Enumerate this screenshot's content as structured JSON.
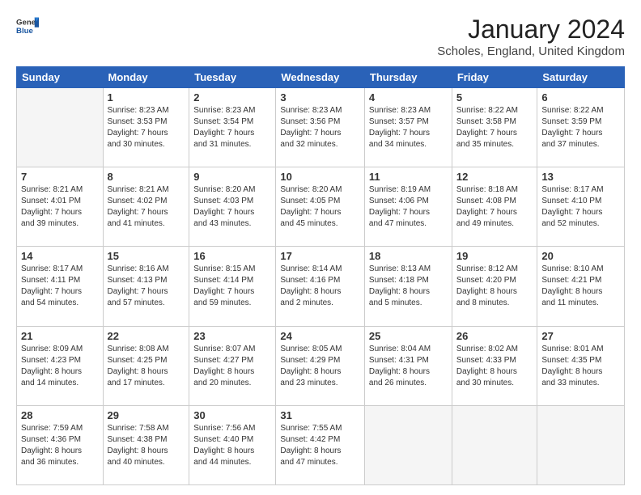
{
  "logo": {
    "general": "General",
    "blue": "Blue"
  },
  "title": "January 2024",
  "location": "Scholes, England, United Kingdom",
  "days_header": [
    "Sunday",
    "Monday",
    "Tuesday",
    "Wednesday",
    "Thursday",
    "Friday",
    "Saturday"
  ],
  "weeks": [
    [
      {
        "day": "",
        "lines": []
      },
      {
        "day": "1",
        "lines": [
          "Sunrise: 8:23 AM",
          "Sunset: 3:53 PM",
          "Daylight: 7 hours",
          "and 30 minutes."
        ]
      },
      {
        "day": "2",
        "lines": [
          "Sunrise: 8:23 AM",
          "Sunset: 3:54 PM",
          "Daylight: 7 hours",
          "and 31 minutes."
        ]
      },
      {
        "day": "3",
        "lines": [
          "Sunrise: 8:23 AM",
          "Sunset: 3:56 PM",
          "Daylight: 7 hours",
          "and 32 minutes."
        ]
      },
      {
        "day": "4",
        "lines": [
          "Sunrise: 8:23 AM",
          "Sunset: 3:57 PM",
          "Daylight: 7 hours",
          "and 34 minutes."
        ]
      },
      {
        "day": "5",
        "lines": [
          "Sunrise: 8:22 AM",
          "Sunset: 3:58 PM",
          "Daylight: 7 hours",
          "and 35 minutes."
        ]
      },
      {
        "day": "6",
        "lines": [
          "Sunrise: 8:22 AM",
          "Sunset: 3:59 PM",
          "Daylight: 7 hours",
          "and 37 minutes."
        ]
      }
    ],
    [
      {
        "day": "7",
        "lines": [
          "Sunrise: 8:21 AM",
          "Sunset: 4:01 PM",
          "Daylight: 7 hours",
          "and 39 minutes."
        ]
      },
      {
        "day": "8",
        "lines": [
          "Sunrise: 8:21 AM",
          "Sunset: 4:02 PM",
          "Daylight: 7 hours",
          "and 41 minutes."
        ]
      },
      {
        "day": "9",
        "lines": [
          "Sunrise: 8:20 AM",
          "Sunset: 4:03 PM",
          "Daylight: 7 hours",
          "and 43 minutes."
        ]
      },
      {
        "day": "10",
        "lines": [
          "Sunrise: 8:20 AM",
          "Sunset: 4:05 PM",
          "Daylight: 7 hours",
          "and 45 minutes."
        ]
      },
      {
        "day": "11",
        "lines": [
          "Sunrise: 8:19 AM",
          "Sunset: 4:06 PM",
          "Daylight: 7 hours",
          "and 47 minutes."
        ]
      },
      {
        "day": "12",
        "lines": [
          "Sunrise: 8:18 AM",
          "Sunset: 4:08 PM",
          "Daylight: 7 hours",
          "and 49 minutes."
        ]
      },
      {
        "day": "13",
        "lines": [
          "Sunrise: 8:17 AM",
          "Sunset: 4:10 PM",
          "Daylight: 7 hours",
          "and 52 minutes."
        ]
      }
    ],
    [
      {
        "day": "14",
        "lines": [
          "Sunrise: 8:17 AM",
          "Sunset: 4:11 PM",
          "Daylight: 7 hours",
          "and 54 minutes."
        ]
      },
      {
        "day": "15",
        "lines": [
          "Sunrise: 8:16 AM",
          "Sunset: 4:13 PM",
          "Daylight: 7 hours",
          "and 57 minutes."
        ]
      },
      {
        "day": "16",
        "lines": [
          "Sunrise: 8:15 AM",
          "Sunset: 4:14 PM",
          "Daylight: 7 hours",
          "and 59 minutes."
        ]
      },
      {
        "day": "17",
        "lines": [
          "Sunrise: 8:14 AM",
          "Sunset: 4:16 PM",
          "Daylight: 8 hours",
          "and 2 minutes."
        ]
      },
      {
        "day": "18",
        "lines": [
          "Sunrise: 8:13 AM",
          "Sunset: 4:18 PM",
          "Daylight: 8 hours",
          "and 5 minutes."
        ]
      },
      {
        "day": "19",
        "lines": [
          "Sunrise: 8:12 AM",
          "Sunset: 4:20 PM",
          "Daylight: 8 hours",
          "and 8 minutes."
        ]
      },
      {
        "day": "20",
        "lines": [
          "Sunrise: 8:10 AM",
          "Sunset: 4:21 PM",
          "Daylight: 8 hours",
          "and 11 minutes."
        ]
      }
    ],
    [
      {
        "day": "21",
        "lines": [
          "Sunrise: 8:09 AM",
          "Sunset: 4:23 PM",
          "Daylight: 8 hours",
          "and 14 minutes."
        ]
      },
      {
        "day": "22",
        "lines": [
          "Sunrise: 8:08 AM",
          "Sunset: 4:25 PM",
          "Daylight: 8 hours",
          "and 17 minutes."
        ]
      },
      {
        "day": "23",
        "lines": [
          "Sunrise: 8:07 AM",
          "Sunset: 4:27 PM",
          "Daylight: 8 hours",
          "and 20 minutes."
        ]
      },
      {
        "day": "24",
        "lines": [
          "Sunrise: 8:05 AM",
          "Sunset: 4:29 PM",
          "Daylight: 8 hours",
          "and 23 minutes."
        ]
      },
      {
        "day": "25",
        "lines": [
          "Sunrise: 8:04 AM",
          "Sunset: 4:31 PM",
          "Daylight: 8 hours",
          "and 26 minutes."
        ]
      },
      {
        "day": "26",
        "lines": [
          "Sunrise: 8:02 AM",
          "Sunset: 4:33 PM",
          "Daylight: 8 hours",
          "and 30 minutes."
        ]
      },
      {
        "day": "27",
        "lines": [
          "Sunrise: 8:01 AM",
          "Sunset: 4:35 PM",
          "Daylight: 8 hours",
          "and 33 minutes."
        ]
      }
    ],
    [
      {
        "day": "28",
        "lines": [
          "Sunrise: 7:59 AM",
          "Sunset: 4:36 PM",
          "Daylight: 8 hours",
          "and 36 minutes."
        ]
      },
      {
        "day": "29",
        "lines": [
          "Sunrise: 7:58 AM",
          "Sunset: 4:38 PM",
          "Daylight: 8 hours",
          "and 40 minutes."
        ]
      },
      {
        "day": "30",
        "lines": [
          "Sunrise: 7:56 AM",
          "Sunset: 4:40 PM",
          "Daylight: 8 hours",
          "and 44 minutes."
        ]
      },
      {
        "day": "31",
        "lines": [
          "Sunrise: 7:55 AM",
          "Sunset: 4:42 PM",
          "Daylight: 8 hours",
          "and 47 minutes."
        ]
      },
      {
        "day": "",
        "lines": []
      },
      {
        "day": "",
        "lines": []
      },
      {
        "day": "",
        "lines": []
      }
    ]
  ]
}
